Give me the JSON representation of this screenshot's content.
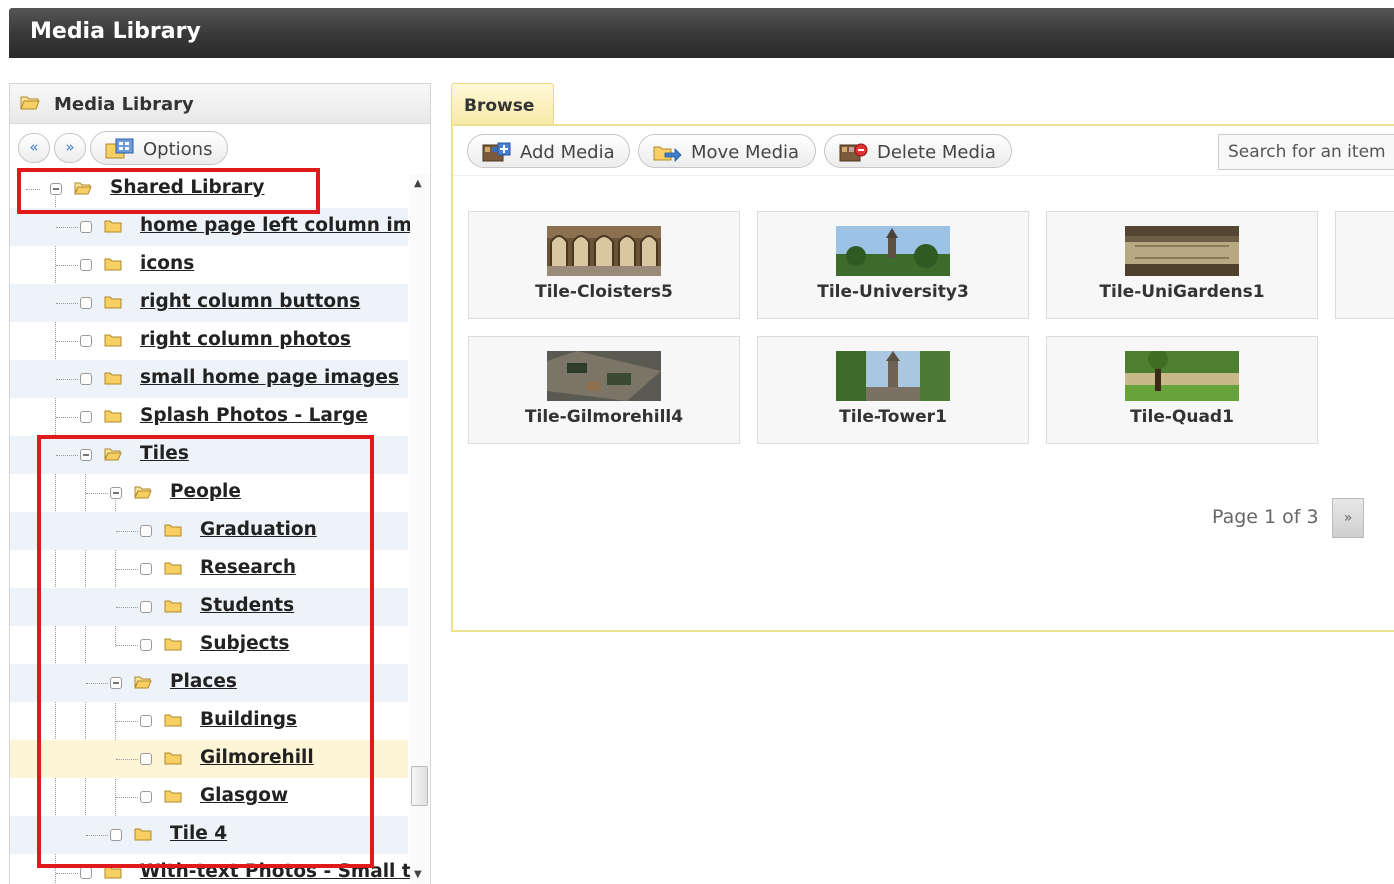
{
  "window": {
    "title": "Media Library"
  },
  "colors": {
    "highlight_box": "#e01a1a",
    "browse_accent": "#ede08f",
    "tree_link": "#222222"
  },
  "sidebar": {
    "header_title": "Media Library",
    "nav_prev": "«",
    "nav_next": "»",
    "options_label": "Options",
    "tree": [
      {
        "label": "Shared Library",
        "expanded": true
      },
      {
        "label": "home page left column im"
      },
      {
        "label": "icons"
      },
      {
        "label": "right column buttons"
      },
      {
        "label": "right column photos"
      },
      {
        "label": "small home page images"
      },
      {
        "label": "Splash Photos - Large"
      },
      {
        "label": "Tiles",
        "expanded": true
      },
      {
        "label": "People",
        "expanded": true
      },
      {
        "label": "Graduation"
      },
      {
        "label": "Research"
      },
      {
        "label": "Students"
      },
      {
        "label": "Subjects"
      },
      {
        "label": "Places",
        "expanded": true
      },
      {
        "label": "Buildings"
      },
      {
        "label": "Gilmorehill",
        "selected": true
      },
      {
        "label": "Glasgow"
      },
      {
        "label": "Tile 4"
      },
      {
        "label": "With-text Photos - Small t"
      }
    ]
  },
  "main": {
    "tab_label": "Browse",
    "toolbar": {
      "add_label": "Add Media",
      "move_label": "Move Media",
      "delete_label": "Delete Media",
      "search_placeholder": "Search for an item"
    },
    "tiles": [
      {
        "label": "Tile-Cloisters5"
      },
      {
        "label": "Tile-University3"
      },
      {
        "label": "Tile-UniGardens1"
      },
      {
        "label": "Tile-Gilmorehill4"
      },
      {
        "label": "Tile-Tower1"
      },
      {
        "label": "Tile-Quad1"
      }
    ],
    "pager": {
      "text": "Page 1 of 3",
      "next": "»"
    }
  }
}
